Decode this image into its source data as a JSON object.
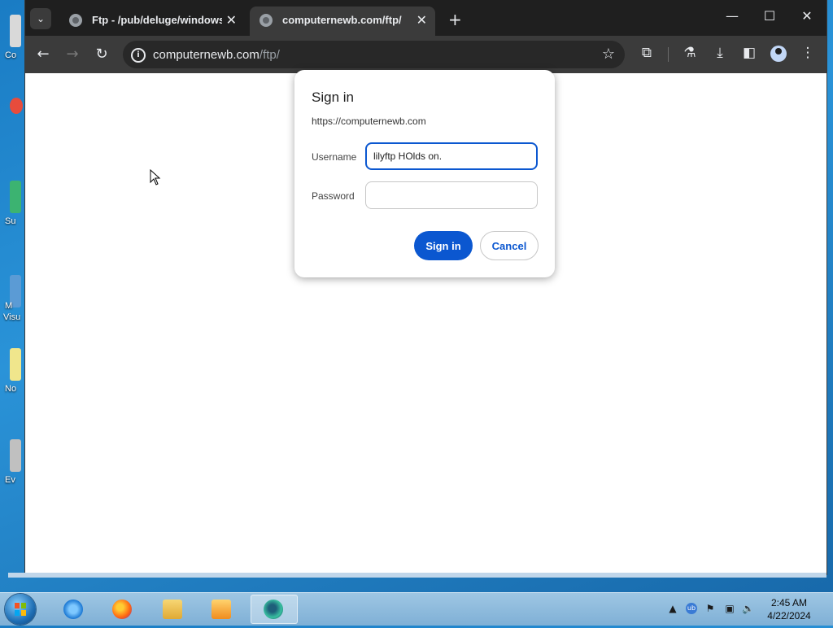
{
  "desktop": {
    "icons": [
      {
        "label": "Co",
        "color": "#d9d9d9"
      },
      {
        "label": "",
        "color": "#e74c3c"
      },
      {
        "label": "Su",
        "color": "#3cb371"
      },
      {
        "label": "M​Visu",
        "label_line1": "M",
        "label_line2": "Visu",
        "color": "#5b9bd5"
      },
      {
        "label": "No",
        "color": "#f0e68c"
      },
      {
        "label": "Ev",
        "color": "#c0c0c0"
      }
    ]
  },
  "browser": {
    "tabs": [
      {
        "title": "Ftp - /pub/deluge/windows/ ::",
        "active": false
      },
      {
        "title": "computernewb.com/ftp/",
        "active": true
      }
    ],
    "new_tab_icon": "+",
    "url_host": "computernewb.com",
    "url_path": "/ftp/"
  },
  "dialog": {
    "title": "Sign in",
    "origin": "https://computernewb.com",
    "username_label": "Username",
    "username_value": "lilyftp HOlds on.",
    "password_label": "Password",
    "password_value": "",
    "sign_in_label": "Sign in",
    "cancel_label": "Cancel"
  },
  "taskbar": {
    "time": "2:45 AM",
    "date": "4/22/2024"
  },
  "colors": {
    "accent": "#0b57d0",
    "chrome_dark": "#1f1f1f",
    "toolbar": "#3b3b3b"
  }
}
